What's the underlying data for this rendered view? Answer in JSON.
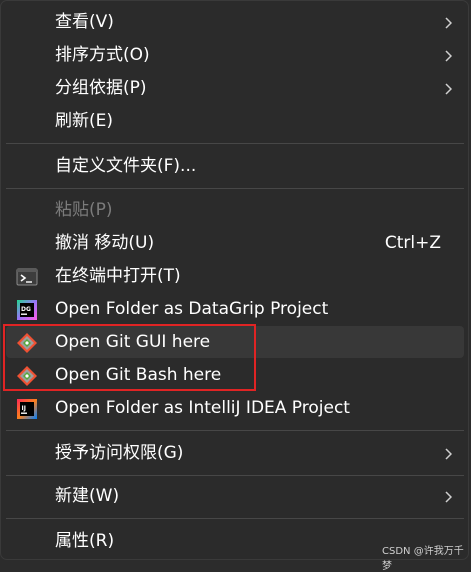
{
  "menu": {
    "items": [
      {
        "label": "查看(V)",
        "has_submenu": true
      },
      {
        "label": "排序方式(O)",
        "has_submenu": true
      },
      {
        "label": "分组依据(P)",
        "has_submenu": true
      },
      {
        "label": "刷新(E)"
      },
      {
        "label": "自定义文件夹(F)..."
      },
      {
        "label": "粘贴(P)",
        "disabled": true
      },
      {
        "label": "撤消 移动(U)",
        "shortcut": "Ctrl+Z"
      },
      {
        "label": "在终端中打开(T)",
        "icon": "terminal-icon"
      },
      {
        "label": "Open Folder as DataGrip Project",
        "icon": "datagrip-icon",
        "icon_text": "DG"
      },
      {
        "label": "Open Git GUI here",
        "icon": "git-icon"
      },
      {
        "label": "Open Git Bash here",
        "icon": "git-icon"
      },
      {
        "label": "Open Folder as IntelliJ IDEA Project",
        "icon": "intellij-icon",
        "icon_text": "IJ"
      },
      {
        "label": "授予访问权限(G)",
        "has_submenu": true
      },
      {
        "label": "新建(W)",
        "has_submenu": true
      },
      {
        "label": "属性(R)"
      }
    ]
  },
  "watermark": "CSDN @许我万千梦",
  "colors": {
    "menu_bg": "#2b2b2b",
    "hover_bg": "#383838",
    "highlight_border": "#e02424",
    "disabled_text": "#7b7b7b"
  }
}
